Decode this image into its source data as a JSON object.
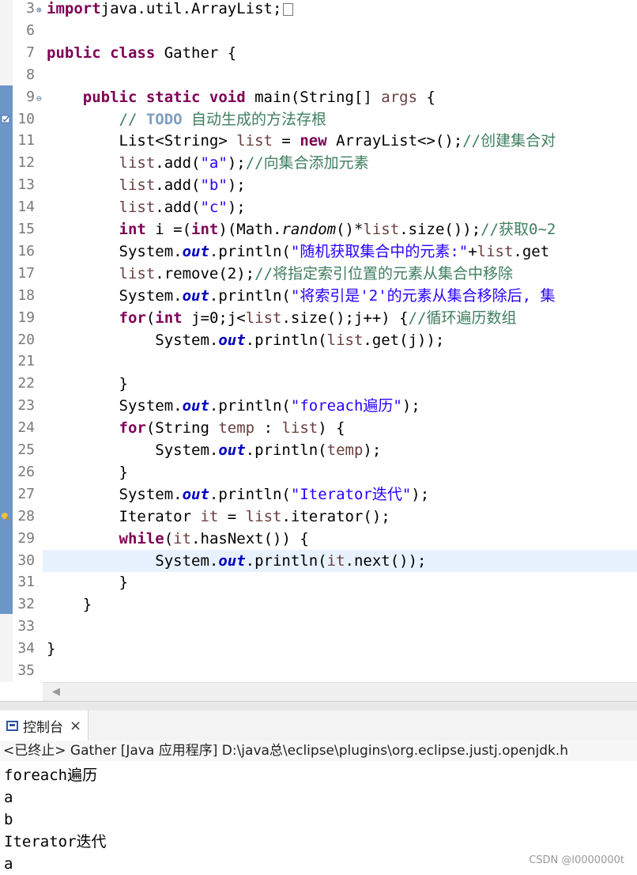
{
  "editor": {
    "lines": [
      {
        "n": "3",
        "fold": "+",
        "tokens": [
          [
            "kw",
            "import"
          ],
          [
            "",
            "java.util.ArrayList;"
          ]
        ]
      },
      {
        "n": "6",
        "tokens": []
      },
      {
        "n": "7",
        "tokens": [
          [
            "kw",
            "public class"
          ],
          [
            "",
            " Gather {"
          ]
        ]
      },
      {
        "n": "8",
        "tokens": []
      },
      {
        "n": "9",
        "fold": "-",
        "tokens": [
          [
            "",
            "    "
          ],
          [
            "kw",
            "public static void"
          ],
          [
            "",
            " main(String[] "
          ],
          [
            "lv",
            "args"
          ],
          [
            "",
            " {"
          ]
        ]
      },
      {
        "n": "10",
        "marker": "task",
        "tokens": [
          [
            "",
            "        "
          ],
          [
            "cm",
            "// "
          ],
          [
            "todo",
            "TODO"
          ],
          [
            "cm",
            " 自动生成的方法存根"
          ]
        ]
      },
      {
        "n": "11",
        "tokens": [
          [
            "",
            "        List<String> "
          ],
          [
            "lv",
            "list"
          ],
          [
            "",
            " = "
          ],
          [
            "kw",
            "new"
          ],
          [
            "",
            " ArrayList<>();"
          ],
          [
            "cm",
            "//创建集合对"
          ]
        ]
      },
      {
        "n": "12",
        "tokens": [
          [
            "",
            "        "
          ],
          [
            "lv",
            "list"
          ],
          [
            "",
            ".add("
          ],
          [
            "st",
            "\"a\""
          ],
          [
            "",
            ");"
          ],
          [
            "cm",
            "//向集合添加元素"
          ]
        ]
      },
      {
        "n": "13",
        "tokens": [
          [
            "",
            "        "
          ],
          [
            "lv",
            "list"
          ],
          [
            "",
            ".add("
          ],
          [
            "st",
            "\"b\""
          ],
          [
            "",
            ");"
          ]
        ]
      },
      {
        "n": "14",
        "tokens": [
          [
            "",
            "        "
          ],
          [
            "lv",
            "list"
          ],
          [
            "",
            ".add("
          ],
          [
            "st",
            "\"c\""
          ],
          [
            "",
            ");"
          ]
        ]
      },
      {
        "n": "15",
        "tokens": [
          [
            "",
            "        "
          ],
          [
            "kw",
            "int"
          ],
          [
            "",
            " i =("
          ],
          [
            "kw",
            "int"
          ],
          [
            "",
            ")(Math."
          ],
          [
            "it",
            "random"
          ],
          [
            "",
            "()*"
          ],
          [
            "lv",
            "list"
          ],
          [
            "",
            ".size());"
          ],
          [
            "cm",
            "//获取0~2"
          ]
        ]
      },
      {
        "n": "16",
        "tokens": [
          [
            "",
            "        System."
          ],
          [
            "fd",
            "out"
          ],
          [
            "",
            ".println("
          ],
          [
            "st",
            "\"随机获取集合中的元素:\""
          ],
          [
            "",
            "+"
          ],
          [
            "lv",
            "list"
          ],
          [
            "",
            ".get"
          ]
        ]
      },
      {
        "n": "17",
        "tokens": [
          [
            "",
            "        "
          ],
          [
            "lv",
            "list"
          ],
          [
            "",
            ".remove(2);"
          ],
          [
            "cm",
            "//将指定索引位置的元素从集合中移除"
          ]
        ]
      },
      {
        "n": "18",
        "tokens": [
          [
            "",
            "        System."
          ],
          [
            "fd",
            "out"
          ],
          [
            "",
            ".println("
          ],
          [
            "st",
            "\"将索引是'2'的元素从集合移除后, 集"
          ]
        ]
      },
      {
        "n": "19",
        "tokens": [
          [
            "",
            "        "
          ],
          [
            "kw",
            "for"
          ],
          [
            "",
            "("
          ],
          [
            "kw",
            "int"
          ],
          [
            "",
            " j=0;j<"
          ],
          [
            "lv",
            "list"
          ],
          [
            "",
            ".size();j++) {"
          ],
          [
            "cm",
            "//循环遍历数组"
          ]
        ]
      },
      {
        "n": "20",
        "tokens": [
          [
            "",
            "            System."
          ],
          [
            "fd",
            "out"
          ],
          [
            "",
            ".println("
          ],
          [
            "lv",
            "list"
          ],
          [
            "",
            ".get(j));"
          ]
        ]
      },
      {
        "n": "21",
        "tokens": []
      },
      {
        "n": "22",
        "tokens": [
          [
            "",
            "        }"
          ]
        ]
      },
      {
        "n": "23",
        "tokens": [
          [
            "",
            "        System."
          ],
          [
            "fd",
            "out"
          ],
          [
            "",
            ".println("
          ],
          [
            "st",
            "\"foreach遍历\""
          ],
          [
            "",
            ");"
          ]
        ]
      },
      {
        "n": "24",
        "tokens": [
          [
            "",
            "        "
          ],
          [
            "kw",
            "for"
          ],
          [
            "",
            "(String "
          ],
          [
            "lv",
            "temp"
          ],
          [
            "",
            " : "
          ],
          [
            "lv",
            "list"
          ],
          [
            "",
            ") {"
          ]
        ]
      },
      {
        "n": "25",
        "tokens": [
          [
            "",
            "            System."
          ],
          [
            "fd",
            "out"
          ],
          [
            "",
            ".println("
          ],
          [
            "lv",
            "temp"
          ],
          [
            "",
            ");"
          ]
        ]
      },
      {
        "n": "26",
        "tokens": [
          [
            "",
            "        }"
          ]
        ]
      },
      {
        "n": "27",
        "tokens": [
          [
            "",
            "        System."
          ],
          [
            "fd",
            "out"
          ],
          [
            "",
            ".println("
          ],
          [
            "st",
            "\"Iterator迭代\""
          ],
          [
            "",
            ");"
          ]
        ]
      },
      {
        "n": "28",
        "marker": "warning",
        "tokens": [
          [
            "",
            "        Iterator "
          ],
          [
            "lv",
            "it"
          ],
          [
            "",
            " = "
          ],
          [
            "lv",
            "list"
          ],
          [
            "",
            ".iterator();"
          ]
        ]
      },
      {
        "n": "29",
        "tokens": [
          [
            "",
            "        "
          ],
          [
            "kw",
            "while"
          ],
          [
            "",
            "("
          ],
          [
            "lv",
            "it"
          ],
          [
            "",
            ".hasNext()) {"
          ]
        ]
      },
      {
        "n": "30",
        "current": true,
        "tokens": [
          [
            "",
            "            System."
          ],
          [
            "fd",
            "out"
          ],
          [
            "",
            ".println("
          ],
          [
            "lv",
            "it"
          ],
          [
            "",
            ".next());"
          ]
        ]
      },
      {
        "n": "31",
        "tokens": [
          [
            "",
            "        }"
          ]
        ]
      },
      {
        "n": "32",
        "tokens": [
          [
            "",
            "    }"
          ]
        ]
      },
      {
        "n": "33",
        "tokens": []
      },
      {
        "n": "34",
        "tokens": [
          [
            "",
            "}"
          ]
        ]
      },
      {
        "n": "35",
        "tokens": []
      }
    ]
  },
  "console": {
    "tab_label": "控制台",
    "close_glyph": "×",
    "status": "<已终止> Gather [Java 应用程序] D:\\java总\\eclipse\\plugins\\org.eclipse.justj.openjdk.h",
    "output": [
      "foreach遍历",
      "a",
      "b",
      "Iterator迭代",
      "a"
    ]
  },
  "scroll_left_glyph": "◀",
  "watermark": "CSDN @l0000000t",
  "colors": {
    "keyword": "#7f0055",
    "comment": "#3f7f5f",
    "string": "#2a00ff",
    "field": "#0000c0",
    "local": "#6a3e3e",
    "current_line": "#e8f2fe",
    "fold_bar": "#6d96c8"
  }
}
